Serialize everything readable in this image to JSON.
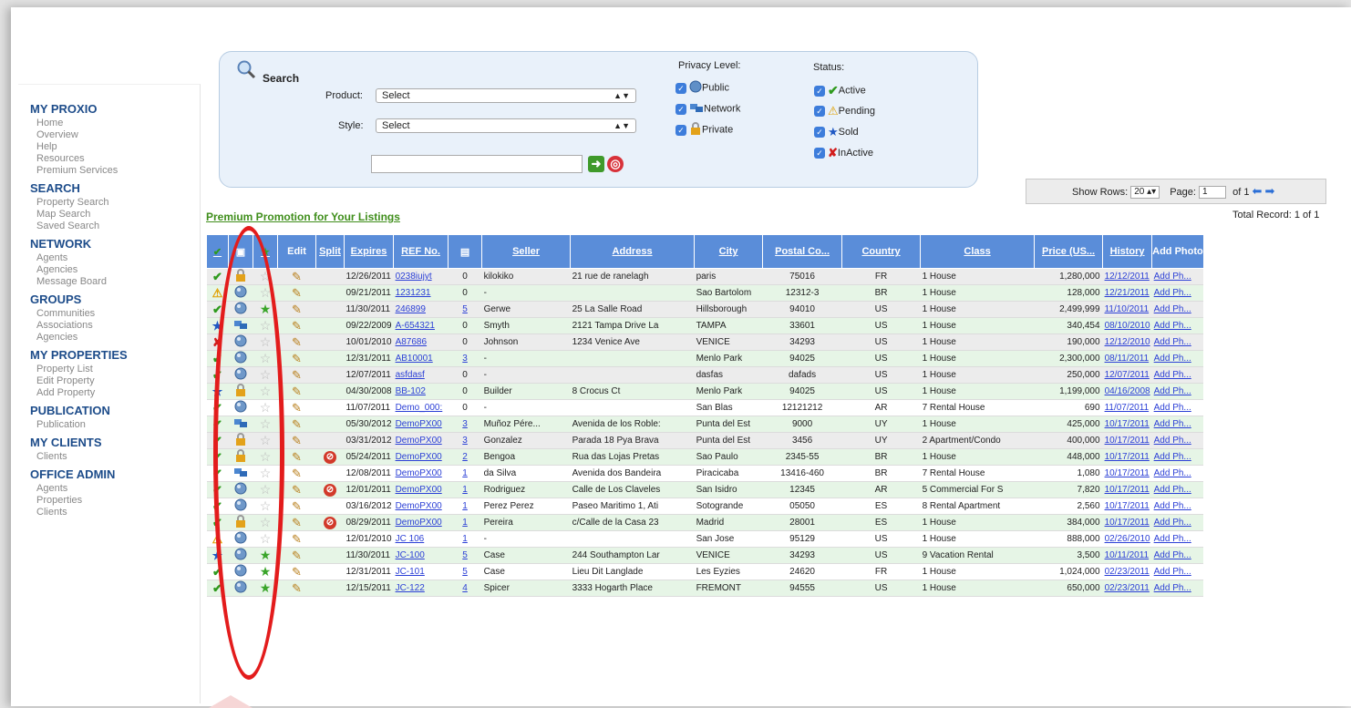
{
  "sidebar": [
    {
      "head": "MY PROXIO",
      "items": [
        "Home",
        "Overview",
        "Help",
        "Resources",
        "Premium Services"
      ]
    },
    {
      "head": "SEARCH",
      "items": [
        "Property Search",
        "Map Search",
        "Saved Search"
      ]
    },
    {
      "head": "NETWORK",
      "items": [
        "Agents",
        "Agencies",
        "Message Board"
      ]
    },
    {
      "head": "GROUPS",
      "items": [
        "Communities",
        "Associations",
        "Agencies"
      ]
    },
    {
      "head": "MY PROPERTIES",
      "items": [
        "Property List",
        "Edit Property",
        "Add Property"
      ]
    },
    {
      "head": "PUBLICATION",
      "items": [
        "Publication"
      ]
    },
    {
      "head": "MY CLIENTS",
      "items": [
        "Clients"
      ]
    },
    {
      "head": "OFFICE ADMIN",
      "items": [
        "Agents",
        "Properties",
        "Clients"
      ]
    }
  ],
  "search": {
    "title": "Search",
    "product_label": "Product:",
    "product_value": "Select",
    "style_label": "Style:",
    "style_value": "Select",
    "text_value": "",
    "privacy_label": "Privacy Level:",
    "privacy": [
      "Public",
      "Network",
      "Private"
    ],
    "status_label": "Status:",
    "status": [
      "Active",
      "Pending",
      "Sold",
      "InActive"
    ]
  },
  "pager": {
    "show_rows_label": "Show Rows:",
    "rows": "20",
    "page_label": "Page:",
    "page": "1",
    "of_label": "of 1"
  },
  "promo_link": "Premium Promotion for Your Listings",
  "total": "Total Record: 1 of 1",
  "columns": [
    "Edit",
    "Split",
    "Expires",
    "REF No.",
    "Seller",
    "Address",
    "City",
    "Postal Co...",
    "Country",
    "Class",
    "Price (US...",
    "History",
    "Add Photo"
  ],
  "rows": [
    {
      "status": "check",
      "privacy": "lock",
      "star": false,
      "split": false,
      "expires": "12/26/2011",
      "ref": "0238iujyt",
      "photos": "0",
      "seller": "kilokiko",
      "address": "21 rue de ranelagh",
      "city": "paris",
      "postal": "75016",
      "country": "FR",
      "cls": "1 House",
      "price": "1,280,000",
      "history": "12/12/2011",
      "addph": "Add Ph..."
    },
    {
      "status": "warn",
      "privacy": "globe",
      "star": false,
      "split": false,
      "expires": "09/21/2011",
      "ref": "1231231",
      "photos": "0",
      "seller": "-",
      "address": "",
      "city": "Sao Bartolom",
      "postal": "12312-3",
      "country": "BR",
      "cls": "1 House",
      "price": "128,000",
      "history": "12/21/2011",
      "addph": "Add Ph..."
    },
    {
      "status": "check",
      "privacy": "globe",
      "star": true,
      "split": false,
      "expires": "11/30/2011",
      "ref": "246899",
      "photos": "5",
      "seller": "Gerwe",
      "address": "25 La Salle Road",
      "city": "Hillsborough",
      "postal": "94010",
      "country": "US",
      "cls": "1 House",
      "price": "2,499,999",
      "history": "11/10/2011",
      "addph": "Add Ph..."
    },
    {
      "status": "sold",
      "privacy": "network",
      "star": false,
      "split": false,
      "expires": "09/22/2009",
      "ref": "A-654321",
      "photos": "0",
      "seller": "Smyth",
      "address": "2121 Tampa Drive La",
      "city": "TAMPA",
      "postal": "33601",
      "country": "US",
      "cls": "1 House",
      "price": "340,454",
      "history": "08/10/2010",
      "addph": "Add Ph..."
    },
    {
      "status": "inactive",
      "privacy": "globe",
      "star": false,
      "split": false,
      "expires": "10/01/2010",
      "ref": "A87686",
      "photos": "0",
      "seller": "Johnson",
      "address": "1234 Venice Ave",
      "city": "VENICE",
      "postal": "34293",
      "country": "US",
      "cls": "1 House",
      "price": "190,000",
      "history": "12/12/2010",
      "addph": "Add Ph..."
    },
    {
      "status": "check",
      "privacy": "globe",
      "star": false,
      "split": false,
      "expires": "12/31/2011",
      "ref": "AB10001",
      "photos": "3",
      "seller": "-",
      "address": "",
      "city": "Menlo Park",
      "postal": "94025",
      "country": "US",
      "cls": "1 House",
      "price": "2,300,000",
      "history": "08/11/2011",
      "addph": "Add Ph..."
    },
    {
      "status": "check",
      "privacy": "globe",
      "star": false,
      "split": false,
      "expires": "12/07/2011",
      "ref": "asfdasf",
      "photos": "0",
      "seller": "-",
      "address": "",
      "city": "dasfas",
      "postal": "dafads",
      "country": "US",
      "cls": "1 House",
      "price": "250,000",
      "history": "12/07/2011",
      "addph": "Add Ph..."
    },
    {
      "status": "sold",
      "privacy": "lock",
      "star": false,
      "split": false,
      "expires": "04/30/2008",
      "ref": "BB-102",
      "photos": "0",
      "seller": "Builder",
      "address": "8 Crocus Ct",
      "city": "Menlo Park",
      "postal": "94025",
      "country": "US",
      "cls": "1 House",
      "price": "1,199,000",
      "history": "04/16/2008",
      "addph": "Add Ph..."
    },
    {
      "status": "check",
      "privacy": "globe",
      "star": false,
      "split": false,
      "expires": "11/07/2011",
      "ref": "Demo_000:",
      "photos": "0",
      "seller": "-",
      "address": "",
      "city": "San Blas",
      "postal": "12121212",
      "country": "AR",
      "cls": "7 Rental House",
      "price": "690",
      "history": "11/07/2011",
      "addph": "Add Ph..."
    },
    {
      "status": "check",
      "privacy": "network",
      "star": false,
      "split": false,
      "expires": "05/30/2012",
      "ref": "DemoPX00",
      "photos": "3",
      "seller": "Muñoz Pére...",
      "address": "Avenida de los Roble:",
      "city": "Punta del Est",
      "postal": "9000",
      "country": "UY",
      "cls": "1 House",
      "price": "425,000",
      "history": "10/17/2011",
      "addph": "Add Ph..."
    },
    {
      "status": "check",
      "privacy": "lock",
      "star": false,
      "split": false,
      "expires": "03/31/2012",
      "ref": "DemoPX00",
      "photos": "3",
      "seller": "Gonzalez",
      "address": "Parada 18 Pya Brava",
      "city": "Punta del Est",
      "postal": "3456",
      "country": "UY",
      "cls": "2 Apartment/Condo",
      "price": "400,000",
      "history": "10/17/2011",
      "addph": "Add Ph..."
    },
    {
      "status": "check",
      "privacy": "lock",
      "star": false,
      "split": true,
      "expires": "05/24/2011",
      "ref": "DemoPX00",
      "photos": "2",
      "seller": "Bengoa",
      "address": "Rua das Lojas Pretas",
      "city": "Sao Paulo",
      "postal": "2345-55",
      "country": "BR",
      "cls": "1 House",
      "price": "448,000",
      "history": "10/17/2011",
      "addph": "Add Ph..."
    },
    {
      "status": "check",
      "privacy": "network",
      "star": false,
      "split": false,
      "expires": "12/08/2011",
      "ref": "DemoPX00",
      "photos": "1",
      "seller": "da Silva",
      "address": "Avenida dos Bandeira",
      "city": "Piracicaba",
      "postal": "13416-460",
      "country": "BR",
      "cls": "7 Rental House",
      "price": "1,080",
      "history": "10/17/2011",
      "addph": "Add Ph..."
    },
    {
      "status": "check",
      "privacy": "globe",
      "star": false,
      "split": true,
      "expires": "12/01/2011",
      "ref": "DemoPX00",
      "photos": "1",
      "seller": "Rodriguez",
      "address": "Calle de Los Claveles",
      "city": "San Isidro",
      "postal": "12345",
      "country": "AR",
      "cls": "5 Commercial For S",
      "price": "7,820",
      "history": "10/17/2011",
      "addph": "Add Ph..."
    },
    {
      "status": "check",
      "privacy": "globe",
      "star": false,
      "split": false,
      "expires": "03/16/2012",
      "ref": "DemoPX00",
      "photos": "1",
      "seller": "Perez Perez",
      "address": "Paseo Maritimo 1, Ati",
      "city": "Sotogrande",
      "postal": "05050",
      "country": "ES",
      "cls": "8 Rental Apartment",
      "price": "2,560",
      "history": "10/17/2011",
      "addph": "Add Ph..."
    },
    {
      "status": "check",
      "privacy": "lock",
      "star": false,
      "split": true,
      "expires": "08/29/2011",
      "ref": "DemoPX00",
      "photos": "1",
      "seller": "Pereira",
      "address": "c/Calle de la Casa 23",
      "city": "Madrid",
      "postal": "28001",
      "country": "ES",
      "cls": "1 House",
      "price": "384,000",
      "history": "10/17/2011",
      "addph": "Add Ph..."
    },
    {
      "status": "warn",
      "privacy": "globe",
      "star": false,
      "split": false,
      "expires": "12/01/2010",
      "ref": "JC 106",
      "photos": "1",
      "seller": "-",
      "address": "",
      "city": "San Jose",
      "postal": "95129",
      "country": "US",
      "cls": "1 House",
      "price": "888,000",
      "history": "02/26/2010",
      "addph": "Add Ph..."
    },
    {
      "status": "sold",
      "privacy": "globe",
      "star": true,
      "split": false,
      "expires": "11/30/2011",
      "ref": "JC-100",
      "photos": "5",
      "seller": "Case",
      "address": "244 Southampton Lar",
      "city": "VENICE",
      "postal": "34293",
      "country": "US",
      "cls": "9 Vacation Rental",
      "price": "3,500",
      "history": "10/11/2011",
      "addph": "Add Ph..."
    },
    {
      "status": "check",
      "privacy": "globe",
      "star": true,
      "split": false,
      "expires": "12/31/2011",
      "ref": "JC-101",
      "photos": "5",
      "seller": "Case",
      "address": "Lieu Dit Langlade",
      "city": "Les Eyzies",
      "postal": "24620",
      "country": "FR",
      "cls": "1 House",
      "price": "1,024,000",
      "history": "02/23/2011",
      "addph": "Add Ph..."
    },
    {
      "status": "check",
      "privacy": "globe",
      "star": true,
      "split": false,
      "expires": "12/15/2011",
      "ref": "JC-122",
      "photos": "4",
      "seller": "Spicer",
      "address": "3333 Hogarth Place",
      "city": "FREMONT",
      "postal": "94555",
      "country": "US",
      "cls": "1 House",
      "price": "650,000",
      "history": "02/23/2011",
      "addph": "Add Ph..."
    }
  ]
}
